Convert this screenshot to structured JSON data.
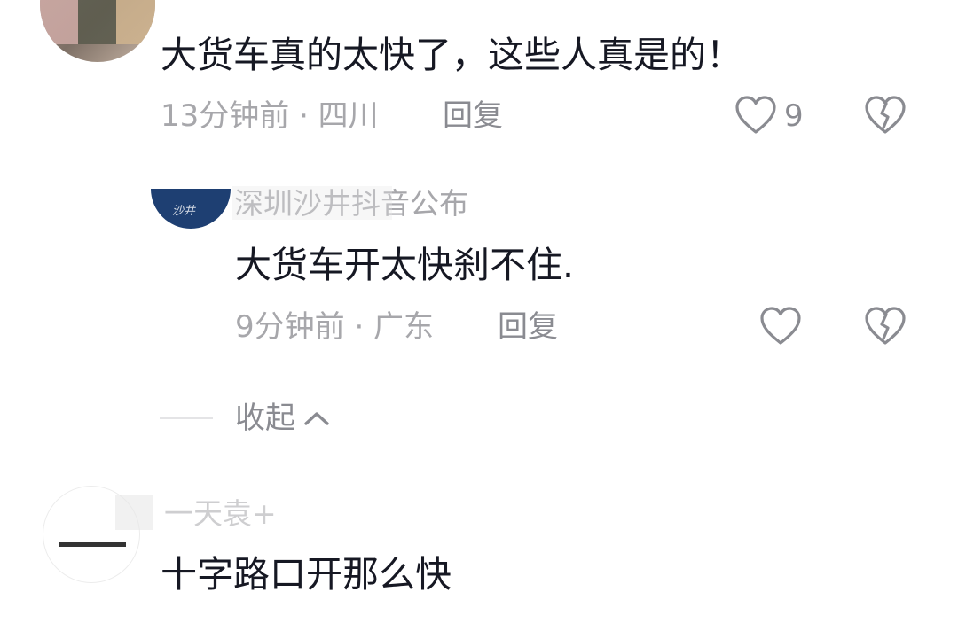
{
  "comments": [
    {
      "text": "大货车真的太快了，这些人真是的！",
      "time_location": "13分钟前 · 四川",
      "reply_label": "回复",
      "like_count": "9",
      "icons": {
        "like": "heart-outline-icon",
        "dislike": "broken-heart-icon"
      }
    },
    {
      "username": "深圳沙井抖音公布",
      "avatar_text": "沙井",
      "text": "大货车开太快刹不住.",
      "time_location": "9分钟前 · 广东",
      "reply_label": "回复",
      "icons": {
        "like": "heart-outline-icon",
        "dislike": "broken-heart-icon"
      }
    },
    {
      "username": "一天袁+",
      "text": "十字路口开那么快"
    }
  ],
  "collapse": {
    "label": "收起",
    "icon": "chevron-up-icon"
  },
  "colors": {
    "text_primary": "#161823",
    "text_secondary": "#a7a7ab",
    "reply_gray": "#8a8b91",
    "avatar_blue": "#1e3f72"
  }
}
